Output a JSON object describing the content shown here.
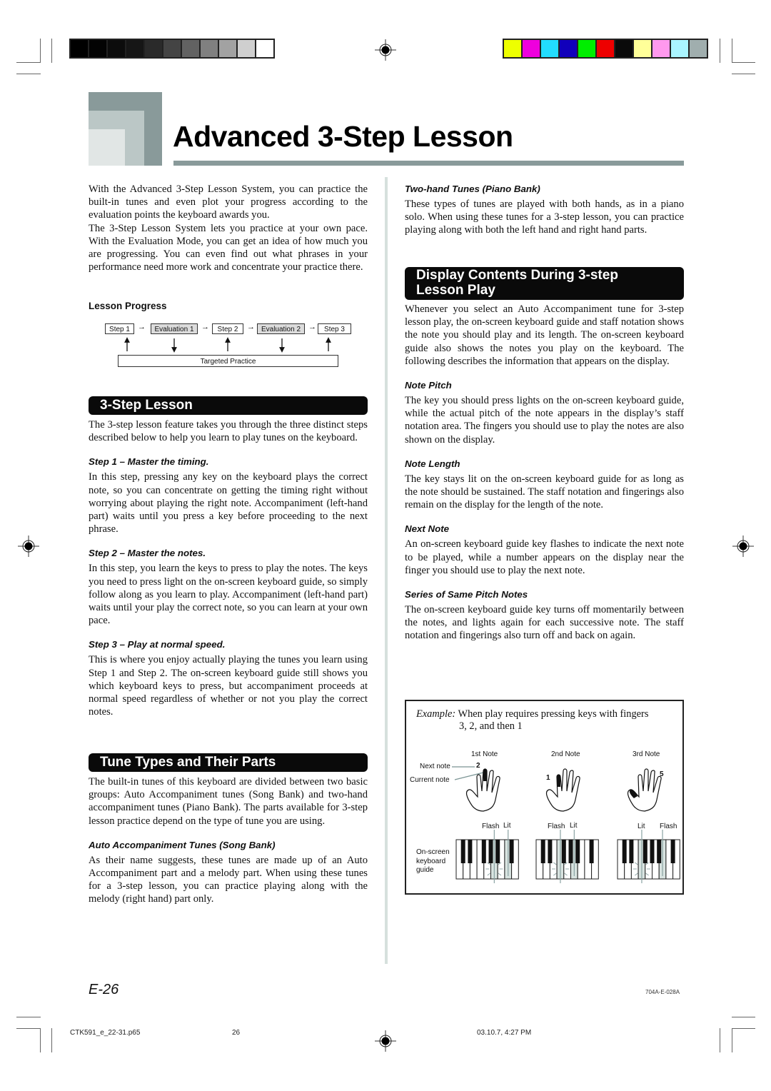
{
  "colors": {
    "gray_swatches": [
      "#000000",
      "#030303",
      "#0c0c0c",
      "#161616",
      "#2a2a2a",
      "#444444",
      "#626262",
      "#808080",
      "#a2a2a2",
      "#cfcfcf",
      "#ffffff"
    ],
    "color_swatches": [
      "#eeff00",
      "#ee00dd",
      "#22ddff",
      "#1100bb",
      "#00ee00",
      "#ee0000",
      "#0a0a0a",
      "#ffff99",
      "#ff99ee",
      "#aaf5ff",
      "#a0aeae"
    ],
    "accent_gray": "#899a9a"
  },
  "header": {
    "title": "Advanced 3-Step Lesson"
  },
  "left": {
    "intro": [
      "With the Advanced 3-Step Lesson System, you can practice the built-in tunes and even plot your progress according to the evaluation points the keyboard awards you.",
      "The 3-Step Lesson System lets you practice at your own pace. With the Evaluation Mode, you can get an idea of how much you are progressing. You can even find out what phrases in your performance need more work and concentrate your practice there."
    ],
    "lesson_progress": {
      "heading": "Lesson Progress",
      "steps": [
        "Step 1",
        "Evaluation 1",
        "Step 2",
        "Evaluation 2",
        "Step 3"
      ],
      "targeted": "Targeted Practice",
      "arrow_glyph": "→"
    },
    "three_step": {
      "banner": "3-Step Lesson",
      "intro": "The 3-step lesson feature takes you through the three distinct steps described below to help you learn to play tunes on the keyboard.",
      "steps": [
        {
          "heading": "Step 1 – Master the timing.",
          "body": "In this step, pressing any key on the keyboard plays the correct note, so you can concentrate on getting the timing right without worrying about playing the right note. Accompaniment (left-hand part) waits until you press a key before proceeding to the next phrase."
        },
        {
          "heading": "Step 2 – Master the notes.",
          "body": "In this step, you learn the keys to press to play the notes. The keys you need to press light on the on-screen keyboard guide, so simply follow along as you learn to play. Accompaniment (left-hand part) waits until your play the correct note, so you can learn at your own pace."
        },
        {
          "heading": "Step 3 – Play at normal speed.",
          "body": "This is where you enjoy actually playing the tunes you learn using Step 1 and Step 2. The on-screen keyboard guide still shows you which keyboard keys to press, but accompaniment proceeds at normal speed regardless of whether or not you play the correct notes."
        }
      ]
    },
    "tune_types": {
      "banner": "Tune Types and Their Parts",
      "intro": "The built-in tunes of this keyboard are divided between two basic groups: Auto Accompaniment tunes (Song Bank) and two-hand accompaniment tunes (Piano Bank). The parts available for 3-step lesson practice depend on the type of tune you are using.",
      "auto": {
        "heading": "Auto Accompaniment Tunes (Song Bank)",
        "body": "As their name suggests, these tunes are made up of an Auto Accompaniment part and a melody part. When using these tunes for a 3-step lesson, you can practice playing along with the melody (right hand) part only."
      }
    }
  },
  "right": {
    "two_hand": {
      "heading": "Two-hand Tunes (Piano Bank)",
      "body": "These types of tunes are played with both hands, as in a piano solo. When using these tunes for a 3-step lesson, you can practice playing along with both the left hand and right hand parts."
    },
    "display": {
      "banner_line1": "Display Contents During 3-step",
      "banner_line2": "Lesson Play",
      "intro": "Whenever you select an Auto Accompaniment tune for 3-step lesson play, the on-screen keyboard guide and staff notation shows the note you should play and its length. The on-screen keyboard guide also shows the notes you play on the keyboard. The following describes the information that appears on the display.",
      "items": [
        {
          "heading": "Note Pitch",
          "body": "The key you should press lights on the on-screen keyboard guide, while the actual pitch of the note appears in the display’s staff notation area. The fingers you should use to play the notes are also shown on the display."
        },
        {
          "heading": "Note Length",
          "body": "The key stays lit on the on-screen keyboard guide for as long as the note should be sustained. The staff notation and fingerings also remain on the display for the length of the note."
        },
        {
          "heading": "Next Note",
          "body": "An on-screen keyboard guide key flashes to indicate the next note to be played, while a number appears on the display near the finger you should use to play the next note."
        },
        {
          "heading": "Series of Same Pitch Notes",
          "body": "The on-screen keyboard guide key turns off momentarily between the notes, and lights again for each successive note. The staff notation and fingerings also turn off and back on again."
        }
      ]
    },
    "example": {
      "label": "Example:",
      "line1": "When play requires pressing keys with fingers",
      "line2": "3, 2, and then 1",
      "next_note": "Next note",
      "current_note": "Current note",
      "keyboard_label_1": "On-screen",
      "keyboard_label_2": "keyboard",
      "keyboard_label_3": "guide",
      "notes": [
        {
          "title": "1st Note",
          "finger_number": "2",
          "label_a": "Flash",
          "label_b": "Lit"
        },
        {
          "title": "2nd Note",
          "finger_number": "1",
          "label_a": "Flash",
          "label_b": "Lit"
        },
        {
          "title": "3rd Note",
          "finger_number": "5",
          "label_a": "Lit",
          "label_b": "Flash"
        }
      ]
    }
  },
  "footer": {
    "page_label": "E-26",
    "code": "704A-E-028A",
    "file": "CTK591_e_22-31.p65",
    "page_number": "26",
    "timestamp": "03.10.7, 4:27 PM"
  }
}
